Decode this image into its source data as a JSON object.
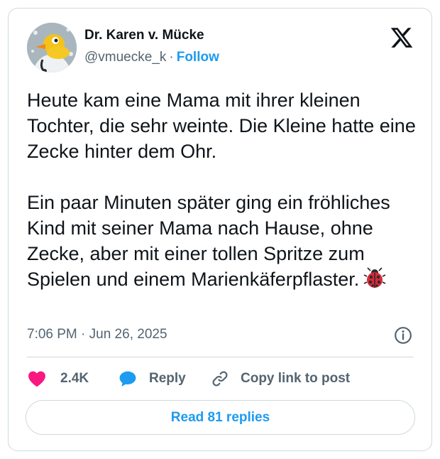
{
  "author": {
    "name": "Dr. Karen v. Mücke",
    "handle": "@vmuecke_k",
    "separator": "·",
    "follow_label": "Follow"
  },
  "tweet": {
    "paragraph1": "Heute kam eine Mama mit ihrer kleinen Tochter, die sehr weinte. Die Kleine hatte eine Zecke hinter dem Ohr.",
    "paragraph2": "Ein paar Minuten später ging ein fröhliches Kind mit seiner Mama nach Hause, ohne Zecke, aber mit einer tollen Spritze zum Spielen und einem Marienkäferpflaster.",
    "emoji_icon": "ladybug-icon",
    "timestamp": "7:06 PM · Jun 26, 2025"
  },
  "actions": {
    "like_count": "2.4K",
    "reply_label": "Reply",
    "copy_label": "Copy link to post"
  },
  "read_replies_label": "Read 81 replies",
  "colors": {
    "accent": "#1d9bf0",
    "like": "#f91880",
    "text": "#0f1419",
    "muted": "#536471",
    "border": "#cfd9de"
  }
}
